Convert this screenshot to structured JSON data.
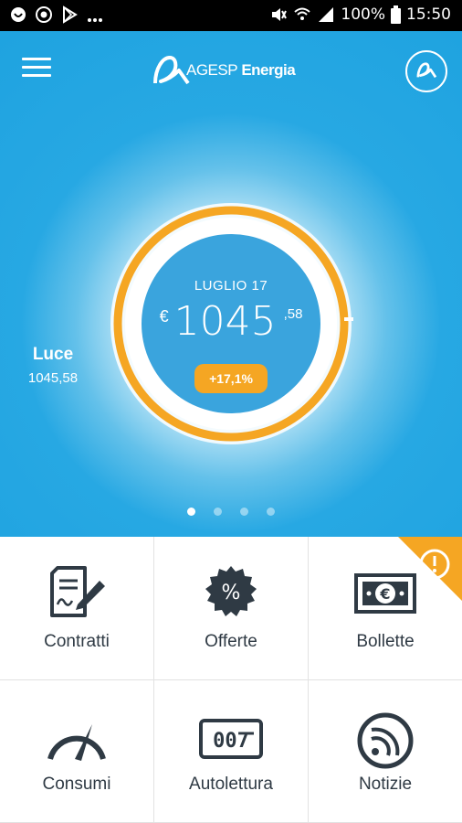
{
  "status_bar": {
    "battery": "100%",
    "time": "15:50",
    "left_icons": [
      "ring-icon",
      "camera-icon",
      "play-store-icon",
      "more-icon"
    ],
    "right_icons": [
      "mute-icon",
      "wifi-icon",
      "signal-icon",
      "battery-icon"
    ]
  },
  "header": {
    "logo_text_main": "AGESP",
    "logo_text_sub": "Energia",
    "menu_icon": "hamburger-icon",
    "profile_icon": "brand-mark-icon"
  },
  "gauge": {
    "month": "LUGLIO 17",
    "currency": "€",
    "amount_int": "1045",
    "amount_dec": ",58",
    "change": "+17,1%",
    "fill_fraction": 1.0,
    "ring_color": "#f5a623"
  },
  "side": {
    "title": "Luce",
    "value": "1045,58"
  },
  "pager": {
    "count": 4,
    "active_index": 0
  },
  "tiles": [
    {
      "label": "Contratti",
      "icon": "contract-icon"
    },
    {
      "label": "Offerte",
      "icon": "percent-badge-icon"
    },
    {
      "label": "Bollette",
      "icon": "euro-banknote-icon",
      "alert": "warning-icon"
    },
    {
      "label": "Consumi",
      "icon": "speedometer-icon"
    },
    {
      "label": "Autolettura",
      "icon": "meter-reading-icon"
    },
    {
      "label": "Notizie",
      "icon": "rss-icon"
    }
  ],
  "colors": {
    "primary_blue": "#1fa3e0",
    "accent_orange": "#f5a623",
    "icon_dark": "#2f3a44"
  }
}
